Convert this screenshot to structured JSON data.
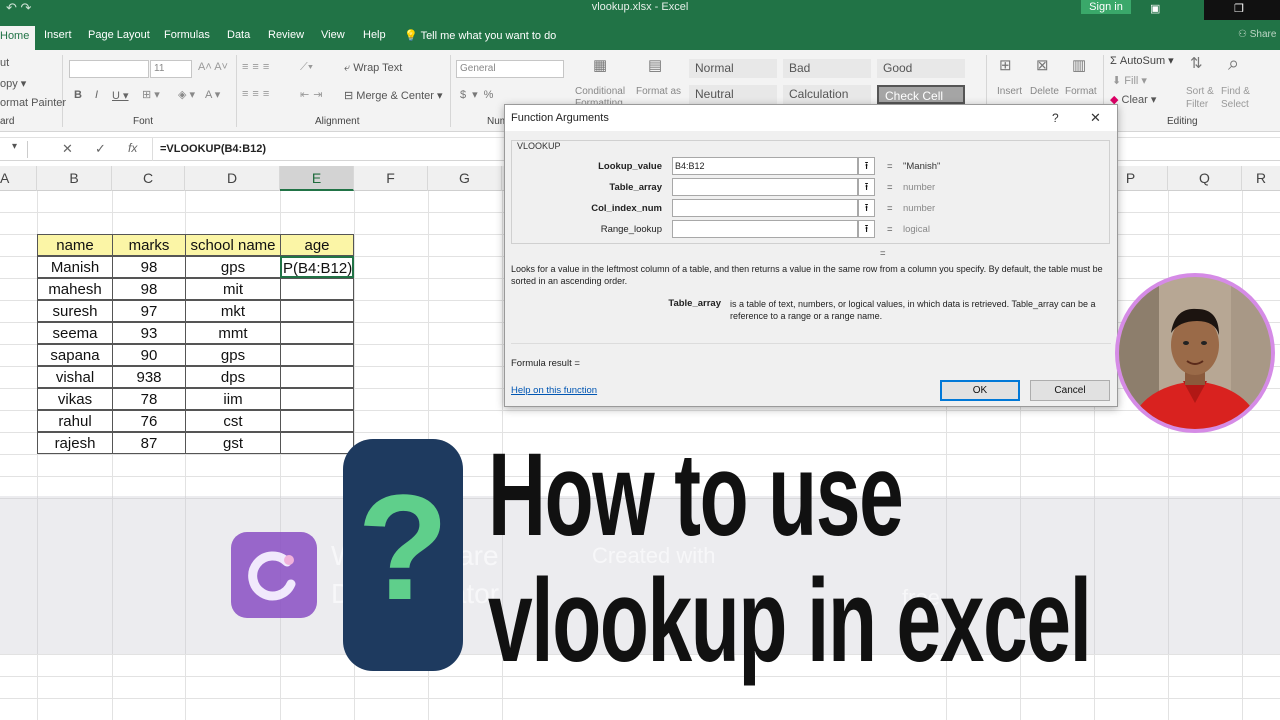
{
  "titlebar": {
    "title": "vlookup.xlsx  -  Excel",
    "signin": "Sign in",
    "quick_access": "↶  ↷"
  },
  "tabs": [
    "Home",
    "Insert",
    "Page Layout",
    "Formulas",
    "Data",
    "Review",
    "View",
    "Help"
  ],
  "tell_me": "Tell me what you want to do",
  "share": "Share",
  "ribbon": {
    "clipboard": {
      "cut": "ut",
      "copy": "opy ▾",
      "format_painter": "ormat Painter",
      "label": "ard"
    },
    "font": {
      "size": "11",
      "label": "Font"
    },
    "alignment": {
      "wrap": "Wrap Text",
      "merge": "Merge & Center",
      "label": "Alignment"
    },
    "number": {
      "format": "General",
      "label": "Num"
    },
    "styles": {
      "cond": "Conditional",
      "cond2": "Formatting",
      "fmt_table": "Format as",
      "normal": "Normal",
      "bad": "Bad",
      "good": "Good",
      "neutral": "Neutral",
      "calculation": "Calculation",
      "check": "Check Cell"
    },
    "cells": {
      "insert": "Insert",
      "delete": "Delete",
      "format": "Format"
    },
    "editing": {
      "autosum": "AutoSum",
      "fill": "Fill",
      "clear": "Clear",
      "sort": "Sort &",
      "sort2": "Filter",
      "find": "Find &",
      "find2": "Select",
      "label": "Editing"
    }
  },
  "formula_bar": {
    "name_box": "",
    "fx": "fx",
    "formula": "=VLOOKUP(B4:B12)"
  },
  "columns": [
    "A",
    "B",
    "C",
    "D",
    "E",
    "F",
    "G",
    "P",
    "Q",
    "R"
  ],
  "table": {
    "headers": [
      "name",
      "marks",
      "school name",
      "age"
    ],
    "rows": [
      [
        "Manish",
        "98",
        "gps",
        "P(B4:B12)"
      ],
      [
        "mahesh",
        "98",
        "mit",
        ""
      ],
      [
        "suresh",
        "97",
        "mkt",
        ""
      ],
      [
        "seema",
        "93",
        "mmt",
        ""
      ],
      [
        "sapana",
        "90",
        "gps",
        ""
      ],
      [
        "vishal",
        "938",
        "dps",
        ""
      ],
      [
        "vikas",
        "78",
        "iim",
        ""
      ],
      [
        "rahul",
        "76",
        "cst",
        ""
      ],
      [
        "rajesh",
        "87",
        "gst",
        ""
      ]
    ]
  },
  "dialog": {
    "title": "Function Arguments",
    "help_q": "?",
    "close": "✕",
    "fn": "VLOOKUP",
    "args": [
      {
        "label": "Lookup_value",
        "value": "B4:B12",
        "result": "\"Manish\""
      },
      {
        "label": "Table_array",
        "value": "",
        "result": "number"
      },
      {
        "label": "Col_index_num",
        "value": "",
        "result": "number"
      },
      {
        "label": "Range_lookup",
        "value": "",
        "result": "logical"
      }
    ],
    "eq": "=",
    "description": "Looks for a value in the leftmost column of a table, and then returns a value in the same row from a column you specify. By default, the table must be sorted in an ascending order.",
    "param_name": "Table_array",
    "param_desc": "is a table of text, numbers, or logical values, in which data is retrieved. Table_array can be a reference to a range or a range name.",
    "formula_result": "Formula result =",
    "help_link": "Help on this function",
    "ok": "OK",
    "cancel": "Cancel"
  },
  "watermark": {
    "line1": "Wondershare",
    "line2": "DemoCreator",
    "created": "Created with",
    "suffix": "free"
  },
  "thumbnail": {
    "q_mark": "?",
    "line1": "How to use",
    "line2": "vlookup in excel"
  },
  "colors": {
    "excel_green": "#217346",
    "badge_navy": "#1e3a5f",
    "q_green": "#5fcf8b",
    "avatar_ring": "#d58be6"
  }
}
